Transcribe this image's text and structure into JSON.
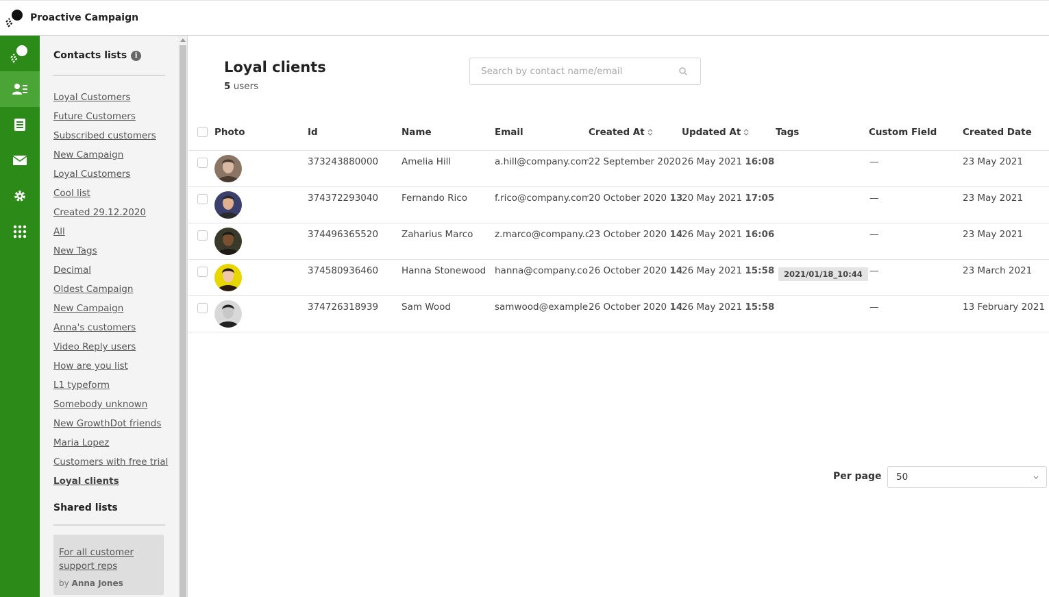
{
  "app": {
    "title": "Proactive Campaign"
  },
  "rail": {
    "items": [
      "campaign-icon",
      "contacts-icon",
      "lists-icon",
      "mail-icon",
      "gear-icon",
      "apps-grid-icon"
    ],
    "active": 1
  },
  "sidebar": {
    "title": "Contacts lists",
    "lists": [
      "Loyal Customers",
      "Future Customers",
      "Subscribed customers",
      "New Campaign",
      "Loyal Customers",
      "Cool list",
      "Created 29.12.2020",
      "All",
      "New Tags",
      "Decimal",
      "Oldest Campaign",
      "New Campaign",
      "Anna's customers",
      "Video Reply users",
      "How are you list",
      "L1 typeform",
      "Somebody unknown",
      "New GrowthDot friends",
      "Maria Lopez",
      "Customers with free trial",
      "Loyal clients"
    ],
    "current_index": 20,
    "shared_title": "Shared lists",
    "shared": {
      "name": "For all customer support reps",
      "by_label": "by",
      "author": "Anna Jones"
    }
  },
  "main": {
    "title": "Loyal clients",
    "count": "5",
    "count_label": "users",
    "search": {
      "placeholder": "Search by contact name/email",
      "value": ""
    },
    "columns": [
      "Photo",
      "Id",
      "Name",
      "Email",
      "Created At",
      "Updated At",
      "Tags",
      "Custom Field",
      "Created Date"
    ],
    "rows": [
      {
        "id": "373243880000",
        "name": "Amelia Hill",
        "email": "a.hill@company.com",
        "created_date": "22 September 2020",
        "created_time": "",
        "updated_date": "26 May 2021",
        "updated_time": "16:08",
        "tag": "",
        "custom": "—",
        "created": "23 May 2021"
      },
      {
        "id": "374372293040",
        "name": "Fernando Rico",
        "email": "f.rico@company.com",
        "created_date": "20 October 2020",
        "created_time": "13",
        "updated_date": "20 May 2021",
        "updated_time": "17:05",
        "tag": "",
        "custom": "—",
        "created": "23 May 2021"
      },
      {
        "id": "374496365520",
        "name": "Zaharius Marco",
        "email": "z.marco@company.com",
        "created_date": "23 October 2020",
        "created_time": "14",
        "updated_date": "26 May 2021",
        "updated_time": "16:06",
        "tag": "",
        "custom": "—",
        "created": "23 May 2021"
      },
      {
        "id": "374580936460",
        "name": "Hanna Stonewood",
        "email": "hanna@company.com",
        "created_date": "26 October 2020",
        "created_time": "14",
        "updated_date": "26 May 2021",
        "updated_time": "15:58",
        "tag": "2021/01/18_10:44",
        "custom": "—",
        "created": "23 March 2021"
      },
      {
        "id": "374726318939",
        "name": "Sam Wood",
        "email": "samwood@example.com",
        "created_date": "26 October 2020",
        "created_time": "14",
        "updated_date": "26 May 2021",
        "updated_time": "15:58",
        "tag": "",
        "custom": "—",
        "created": "13 February 2021"
      }
    ],
    "per_page": {
      "label": "Per page",
      "value": "50"
    }
  },
  "colors": {
    "rail": "#2b8a18",
    "rail_active": "#4aa436",
    "sidebar_bg": "#f4f4f4"
  }
}
